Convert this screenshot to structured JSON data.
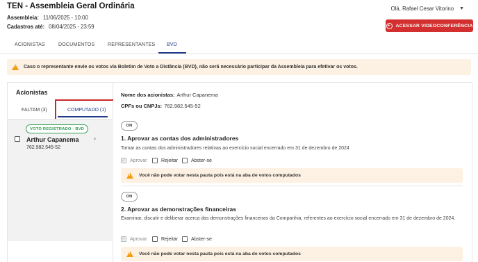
{
  "header": {
    "title": "TEN - Assembleia Geral Ordinária",
    "assembly_label": "Assembleia:",
    "assembly_value": "11/06/2025 - 10:00",
    "registration_label": "Cadastros até:",
    "registration_value": "08/04/2025 - 23:59",
    "user_greeting": "Olá, Rafael Cesar Vitorino",
    "video_button": "ACESSAR VIDEOCONFERÊNCIA"
  },
  "tabs": [
    "ACIONISTAS",
    "DOCUMENTOS",
    "REPRESENTANTES",
    "BVD"
  ],
  "active_tab": "BVD",
  "alert": "Caso o representante envie os votos via Boletim de Voto a Distância (BVD), não será necessário participar da Assembleia para efetivar os votos.",
  "left_panel": {
    "title": "Acionistas",
    "tab_pending": "FALTAM (3)",
    "tab_computed": "COMPUTADO (1)",
    "item": {
      "badge": "VOTO REGISTRADO - BVD",
      "name": "Arthur Capanema",
      "document": "762.982.545-52"
    }
  },
  "detail": {
    "names_label": "Nome dos acionistas:",
    "names_value": "Arthur Capanema",
    "cpf_label": "CPFs ou CNPJs:",
    "cpf_value": "762.982.545-52",
    "toggle_label": "ON",
    "option_approve": "Aprovar",
    "option_reject": "Rejeitar",
    "option_abstain": "Abster-se",
    "notice": "Você não pode votar nesta pauta pois está na aba de votos computados",
    "items": [
      {
        "title": "1. Aprovar as contas dos administradores",
        "description": "Tomar as contas dos administradores relativas ao exercício social encerrado em 31 de dezembro de 2024"
      },
      {
        "title": "2. Aprovar as demonstrações financeiras",
        "description": "Examinar, discutir e deliberar acerca das demonstrações financeiras da Companhia, referentes ao exercício social encerrado em 31 de dezembro de 2024."
      }
    ]
  },
  "colors": {
    "accent": "#1e3a8a",
    "danger": "#d32f2f",
    "success": "#2e9e4f",
    "warning_bg": "#fdf1e3",
    "warning_icon": "#f39c12"
  }
}
